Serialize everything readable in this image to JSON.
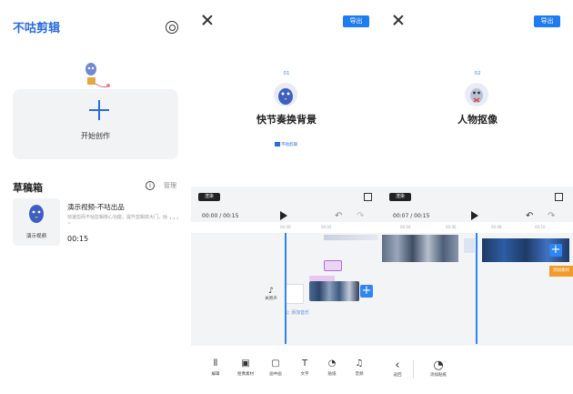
{
  "home": {
    "logo": "不咕剪辑",
    "create_label": "开始创作",
    "drafts_heading": "草稿箱",
    "manage_label": "管理",
    "draft": {
      "thumb_caption": "演示视频",
      "title": "演示视频-不咕出品",
      "description": "快速剪而不咕剪辑核心功能，提升剪辑效大门。咕 ~",
      "duration": "00:15",
      "more": "···"
    }
  },
  "panel2": {
    "export_label": "导出",
    "step_number": "01",
    "template_title": "快节奏换背景",
    "brand": "不咕剪辑",
    "render_label": "渲染",
    "timecode": "00:00 / 00:15",
    "ruler_ticks": [
      "00:00",
      "00:02"
    ],
    "side_label": "关原声",
    "music_label": "添加音乐",
    "tools": [
      {
        "icon": "split-icon",
        "label": "编辑"
      },
      {
        "icon": "media-icon",
        "label": "抠像素材"
      },
      {
        "icon": "pip-icon",
        "label": "画中画"
      },
      {
        "icon": "text-icon",
        "label": "文字"
      },
      {
        "icon": "sticker-icon",
        "label": "贴纸"
      },
      {
        "icon": "audio-icon",
        "label": "音频"
      }
    ]
  },
  "panel3": {
    "export_label": "导出",
    "step_number": "02",
    "template_title": "人物抠像",
    "render_label": "渲染",
    "timecode": "00:07 / 00:15",
    "ruler_ticks": [
      "00:04",
      "00:06",
      "00:08",
      "00:10"
    ],
    "add_button": "添加素材",
    "back_label": "返回",
    "sticker_label": "添加贴纸"
  },
  "colors": {
    "accent": "#2a6be0",
    "export_button": "#1e7cf2",
    "playhead": "#2d86f3",
    "orange_clip": "#f29b2b"
  }
}
